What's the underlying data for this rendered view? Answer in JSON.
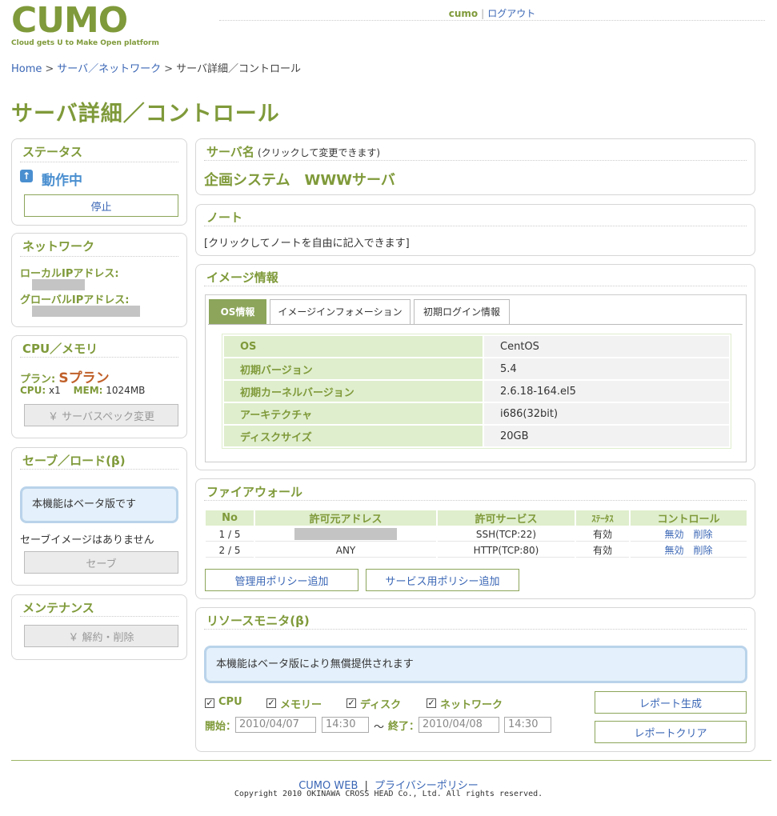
{
  "header": {
    "logo_text": "CUMO",
    "logo_tagline": "Cloud gets U to Make Open platform",
    "username": "cumo",
    "logout_label": "ログアウト"
  },
  "breadcrumb": {
    "home": "Home",
    "network": "サーバ／ネットワーク",
    "current": "サーバ詳細／コントロール"
  },
  "page_title": "サーバ詳細／コントロール",
  "status": {
    "title": "ステータス",
    "state": "動作中",
    "stop_label": "停止"
  },
  "network": {
    "title": "ネットワーク",
    "local_ip_label": "ローカルIPアドレス:",
    "global_ip_label": "グローバルIPアドレス:"
  },
  "cpu_memory": {
    "title": "CPU／メモリ",
    "plan_label": "プラン:",
    "plan_value": "Sプラン",
    "cpu_label": "CPU:",
    "cpu_value": "x1",
    "mem_label": "MEM:",
    "mem_value": "1024MB",
    "spec_change_label": "￥ サーバスペック変更"
  },
  "save_load": {
    "title": "セーブ／ロード(β)",
    "beta_notice": "本機能はベータ版です",
    "no_images": "セーブイメージはありません",
    "save_label": "セーブ"
  },
  "maintenance": {
    "title": "メンテナンス",
    "cancel_label": "￥ 解約・削除"
  },
  "server_name": {
    "title": "サーバ名",
    "hint": "(クリックして変更できます)",
    "value": "企画システム　WWWサーバ"
  },
  "note": {
    "title": "ノート",
    "placeholder": "[クリックしてノートを自由に記入できます]"
  },
  "image_info": {
    "title": "イメージ情報",
    "tabs": [
      "OS情報",
      "イメージインフォメーション",
      "初期ログイン情報"
    ],
    "rows": [
      {
        "key": "OS",
        "value": "CentOS"
      },
      {
        "key": "初期バージョン",
        "value": "5.4"
      },
      {
        "key": "初期カーネルバージョン",
        "value": "2.6.18-164.el5"
      },
      {
        "key": "アーキテクチャ",
        "value": "i686(32bit)"
      },
      {
        "key": "ディスクサイズ",
        "value": "20GB"
      }
    ]
  },
  "firewall": {
    "title": "ファイアウォール",
    "columns": [
      "No",
      "許可元アドレス",
      "許可サービス",
      "ｽﾃｰﾀｽ",
      "コントロール"
    ],
    "rows": [
      {
        "no": "1 / 5",
        "source": "",
        "service": "SSH(TCP:22)",
        "status": "有効",
        "disable": "無効",
        "delete": "削除"
      },
      {
        "no": "2 / 5",
        "source": "ANY",
        "service": "HTTP(TCP:80)",
        "status": "有効",
        "disable": "無効",
        "delete": "削除"
      }
    ],
    "add_admin_policy": "管理用ポリシー追加",
    "add_service_policy": "サービス用ポリシー追加"
  },
  "resource_monitor": {
    "title": "リソースモニタ(β)",
    "notice": "本機能はベータ版により無償提供されます",
    "checks": [
      "CPU",
      "メモリー",
      "ディスク",
      "ネットワーク"
    ],
    "start_label": "開始：",
    "start_date": "2010/04/07",
    "start_time": "14:30",
    "tilde": "～",
    "end_label": "終了：",
    "end_date": "2010/04/08",
    "end_time": "14:30",
    "report_generate": "レポート生成",
    "report_clear": "レポートクリア"
  },
  "footer": {
    "cumo_web": "CUMO WEB",
    "separator": "|",
    "privacy": "プライバシーポリシー",
    "copyright": "Copyright 2010 OKINAWA CROSS HEAD Co., Ltd. All rights reserved."
  },
  "colors": {
    "brand_green": "#7f9a3a",
    "link_blue": "#3a66b5",
    "plan_orange": "#c0602a"
  }
}
